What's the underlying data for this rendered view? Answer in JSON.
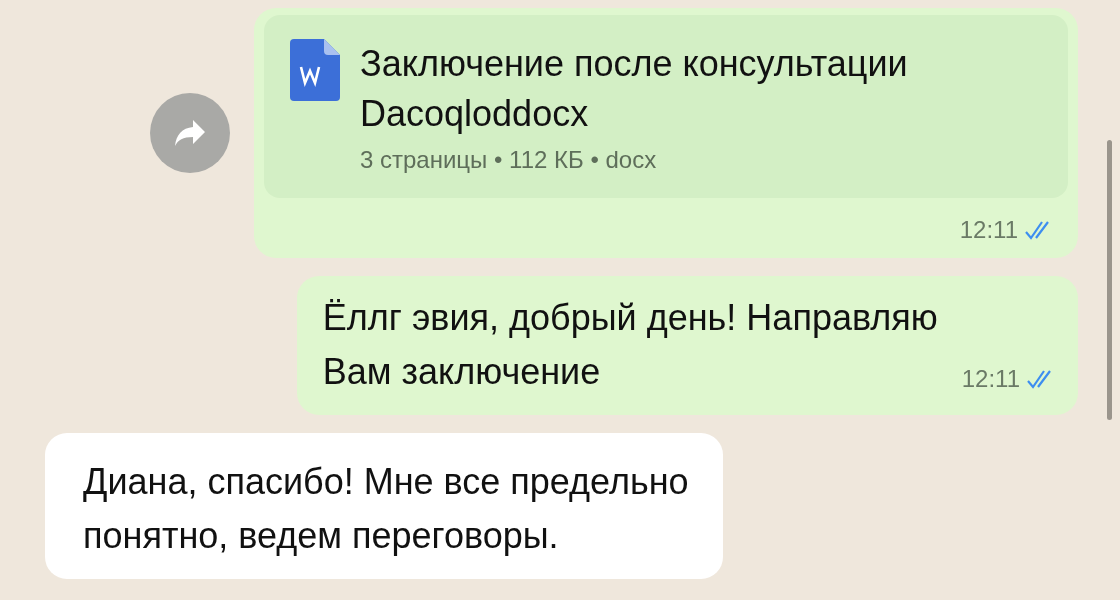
{
  "messages": [
    {
      "kind": "document",
      "outgoing": true,
      "forward": true,
      "file": {
        "title": "Заключение после консультации",
        "name": "Dacoqloddocx",
        "meta": "3 страницы • 112 КБ • docx"
      },
      "time": "12:11",
      "read": true
    },
    {
      "kind": "text",
      "outgoing": true,
      "forward": false,
      "lines": [
        "Ёллг эвия, добрый день! Направляю",
        "Вам заключение"
      ],
      "time": "12:11",
      "read": true
    },
    {
      "kind": "text",
      "outgoing": false,
      "forward": false,
      "lines": [
        "Диана, спасибо! Мне все предельно",
        "понятно, ведем переговоры."
      ]
    }
  ]
}
